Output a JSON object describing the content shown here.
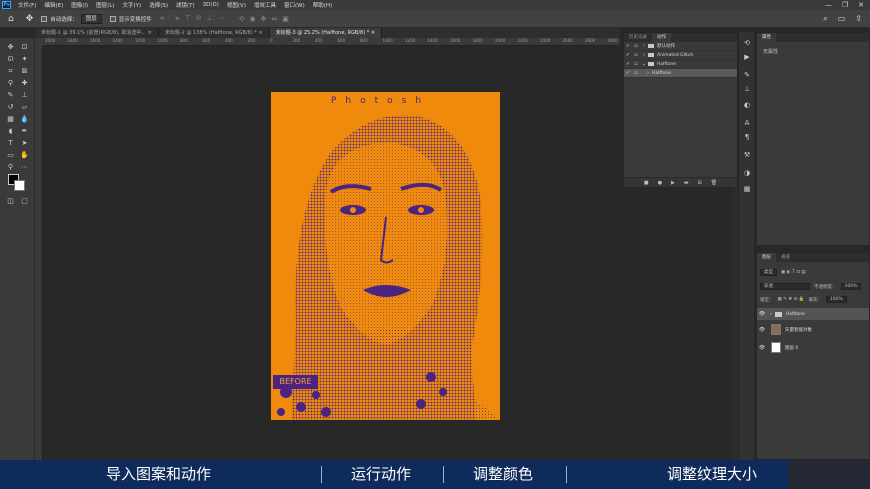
{
  "menubar": {
    "app_icon": "Ps",
    "items": [
      "文件(F)",
      "编辑(E)",
      "图像(I)",
      "图层(L)",
      "文字(Y)",
      "选择(S)",
      "滤镜(T)",
      "3D(D)",
      "视图(V)",
      "增效工具",
      "窗口(W)",
      "帮助(H)"
    ],
    "window_controls": [
      "—",
      "❐",
      "✕"
    ]
  },
  "options": {
    "auto_select_label": "自动选择：",
    "auto_select_value": "图层",
    "transform_label": "显示变换控件"
  },
  "tabs": [
    {
      "label": "未标题-1 @ 39.1% (前景(RGB/8), 取消选中...",
      "active": false
    },
    {
      "label": "未标题-2 @ 138% (Halftone, RGB/8) *",
      "active": false
    },
    {
      "label": "未标题-3 @ 25.2% (Halftone, RGB/8) *",
      "active": true
    }
  ],
  "ruler_ticks": [
    "2000",
    "1800",
    "1600",
    "1400",
    "1200",
    "1000",
    "800",
    "600",
    "400",
    "200",
    "0",
    "200",
    "400",
    "600",
    "800",
    "1000",
    "1200",
    "1400",
    "1600",
    "1800",
    "2000",
    "2200",
    "2400",
    "2600",
    "2800",
    "3000",
    "3200",
    "3400",
    "3600",
    "3800",
    "4000"
  ],
  "document": {
    "title_text": "Photosh",
    "before_label": "BEFORE"
  },
  "actions_panel": {
    "tabs": [
      "历史记录",
      "动作"
    ],
    "rows": [
      {
        "label": "默认动作",
        "type": "folder"
      },
      {
        "label": "Animated Glitch",
        "type": "folder"
      },
      {
        "label": "Halftone",
        "type": "folder"
      },
      {
        "label": "Halftone",
        "type": "action"
      }
    ],
    "footer_icons": [
      "■",
      "●",
      "▶",
      "▬",
      "⊞",
      "🗑"
    ]
  },
  "properties_panel": {
    "tabs": [
      "属性"
    ],
    "empty_label": "无属性"
  },
  "layers_panel": {
    "tabs": [
      "图层",
      "通道"
    ],
    "filter_label": "类型",
    "blend_mode": "穿透",
    "opacity_label": "不透明度：",
    "opacity_value": "100%",
    "lock_label": "锁定：",
    "fill_label": "填充：",
    "fill_value": "100%",
    "layers": [
      {
        "name": "Halftone",
        "type": "group",
        "selected": true
      },
      {
        "name": "矢量智能对象",
        "type": "smart",
        "selected": false
      },
      {
        "name": "图层 0",
        "type": "pixel",
        "selected": false
      }
    ]
  },
  "subtitle_bar": {
    "segments": [
      "导入图案和动作",
      "运行动作",
      "调整颜色",
      "调整纹理大小"
    ],
    "separator": "|"
  },
  "colors": {
    "accent_orange": "#f08a0c",
    "accent_purple": "#4b2380",
    "subtitle_bg": "#0f2b5c"
  }
}
